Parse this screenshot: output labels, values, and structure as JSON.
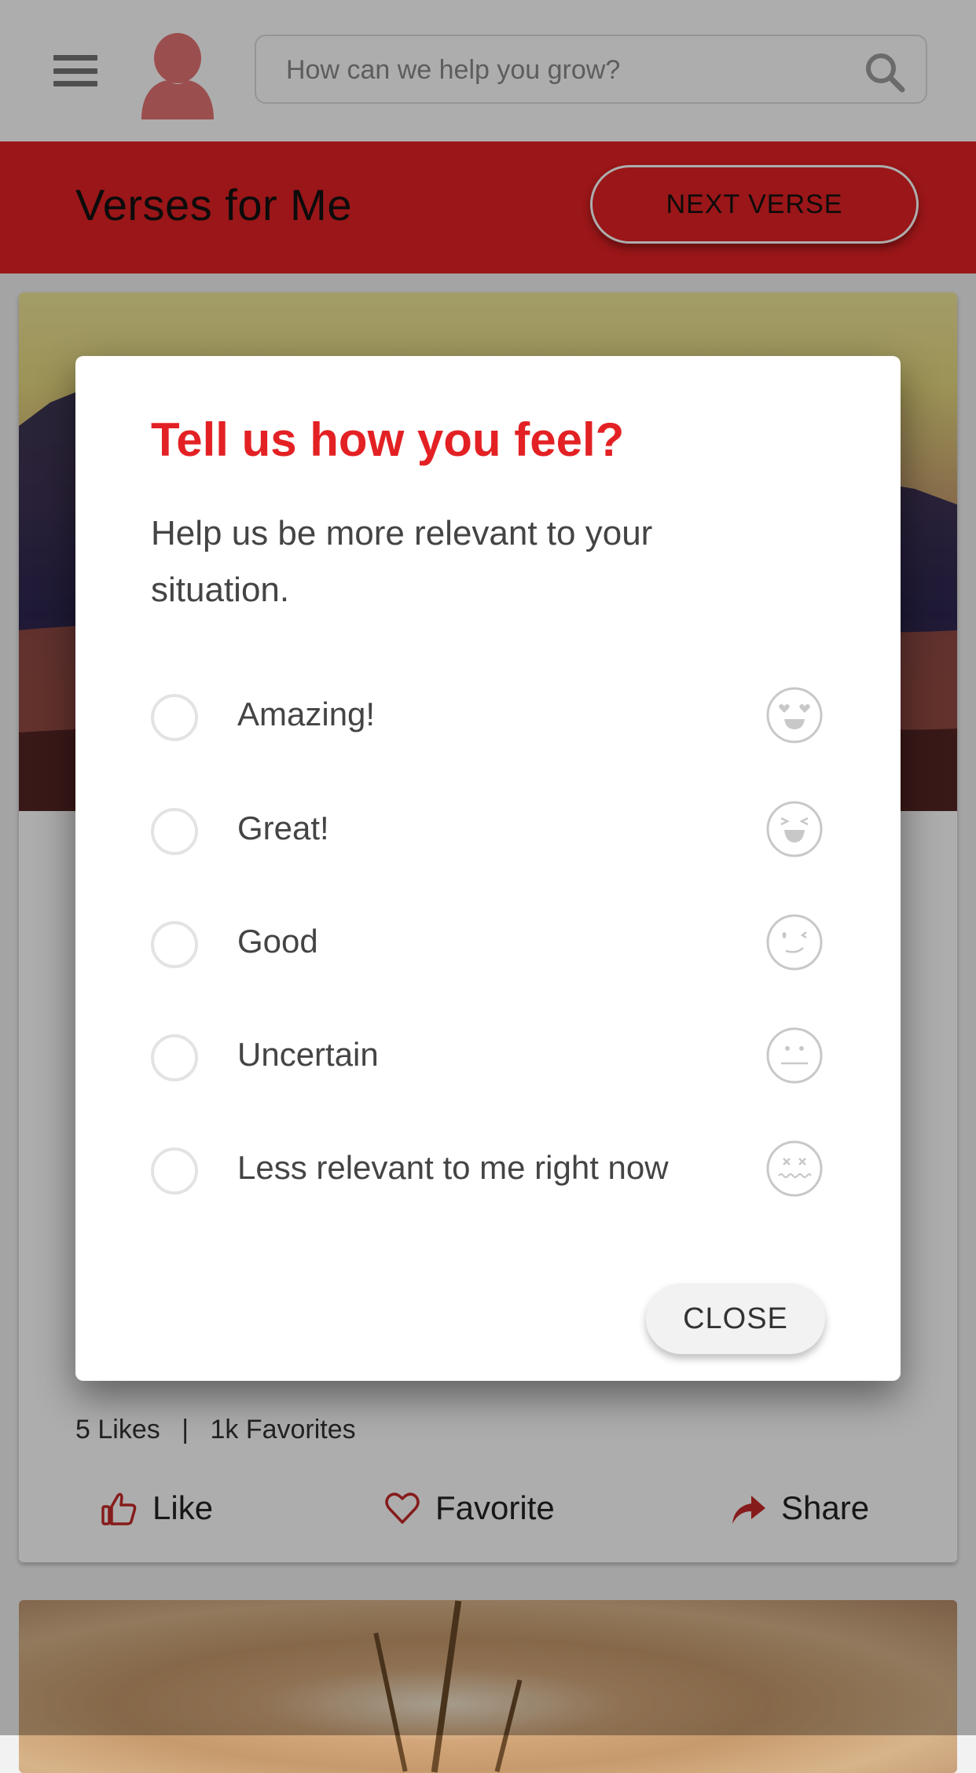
{
  "header": {
    "search": {
      "placeholder": "How can we help you grow?",
      "value": ""
    },
    "icons": {
      "menu": "hamburger-icon",
      "profile": "user-avatar-icon",
      "search": "search-icon"
    }
  },
  "banner": {
    "title": "Verses for Me",
    "next_button_label": "NEXT VERSE",
    "color": "#e32124"
  },
  "card": {
    "stats": {
      "likes": "5 Likes",
      "separator": "|",
      "favorites": "1k Favorites"
    },
    "actions": [
      {
        "label": "Like",
        "icon": "thumbs-up-icon"
      },
      {
        "label": "Favorite",
        "icon": "heart-icon"
      },
      {
        "label": "Share",
        "icon": "share-arrow-icon"
      }
    ]
  },
  "modal": {
    "title": "Tell us how you feel?",
    "subtitle": "Help us be more relevant to your situation.",
    "options": [
      {
        "label": "Amazing!",
        "emoji": "heart-eyes-emoji-icon",
        "selected": false
      },
      {
        "label": "Great!",
        "emoji": "laughing-emoji-icon",
        "selected": false
      },
      {
        "label": "Good",
        "emoji": "winking-emoji-icon",
        "selected": false
      },
      {
        "label": "Uncertain",
        "emoji": "neutral-emoji-icon",
        "selected": false
      },
      {
        "label": "Less relevant to me right now",
        "emoji": "dizzy-emoji-icon",
        "selected": false
      }
    ],
    "close_label": "CLOSE",
    "title_color": "#e32124"
  }
}
